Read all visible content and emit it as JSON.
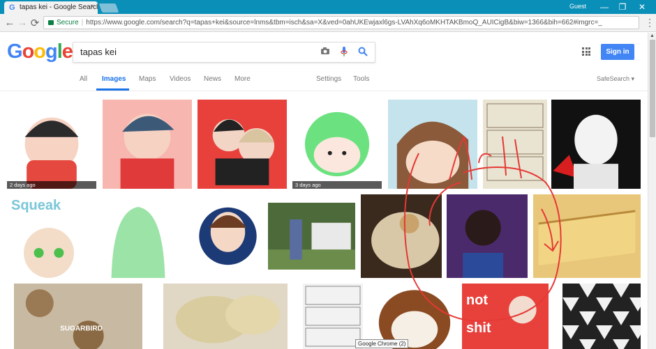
{
  "browser": {
    "tab_title": "tapas kei - Google Search",
    "tab_favicon": "G",
    "tab_close": "×",
    "user": "Guest",
    "window_buttons": [
      "—",
      "❐",
      "✕"
    ],
    "secure_label": "Secure",
    "url": "https://www.google.com/search?q=tapas+kei&source=lnms&tbm=isch&sa=X&ved=0ahUKEwjaxl6gs-LVAhXq6oMKHTAKBmoQ_AUICigB&biw=1366&bih=662#imgrc=_",
    "nav_icons": [
      "←",
      "→",
      "⟳"
    ],
    "menu_icon": "⋮"
  },
  "google": {
    "logo_letters": [
      {
        "char": "G",
        "color": "#4285f4"
      },
      {
        "char": "o",
        "color": "#ea4335"
      },
      {
        "char": "o",
        "color": "#fbbc05"
      },
      {
        "char": "g",
        "color": "#4285f4"
      },
      {
        "char": "l",
        "color": "#34a853"
      },
      {
        "char": "e",
        "color": "#ea4335"
      }
    ],
    "query": "tapas kei",
    "sign_in": "Sign in"
  },
  "tabs": {
    "all": "All",
    "images": "Images",
    "maps": "Maps",
    "videos": "Videos",
    "news": "News",
    "more": "More",
    "settings": "Settings",
    "tools": "Tools",
    "safesearch": "SafeSearch ▾"
  },
  "results": {
    "rows": [
      [
        {
          "subject": "chibi boy red hoodie",
          "bg": "#ffffff",
          "timestamp": "2 days ago"
        },
        {
          "subject": "boy red shirt wink",
          "bg": "#f7b7b0",
          "timestamp": ""
        },
        {
          "subject": "couple red scarf",
          "bg": "#e8413c",
          "timestamp": ""
        },
        {
          "subject": "green hair chibi",
          "bg": "#ffffff",
          "timestamp": "3 days ago"
        },
        {
          "subject": "brown hair boy",
          "bg": "#c5e3ec",
          "timestamp": ""
        },
        {
          "subject": "comic page",
          "bg": "#e9e3d2",
          "timestamp": ""
        },
        {
          "subject": "boy black white",
          "bg": "#111111",
          "timestamp": ""
        }
      ],
      [
        {
          "subject": "squeak tales girl",
          "bg": "#ffffff",
          "timestamp": ""
        },
        {
          "subject": "green ghost sketch",
          "bg": "#ffffff",
          "timestamp": ""
        },
        {
          "subject": "horned girl",
          "bg": "#ffffff",
          "timestamp": ""
        },
        {
          "subject": "woman outdoors photo",
          "bg": "#4d6b3a",
          "timestamp": ""
        },
        {
          "subject": "tapas dish",
          "bg": "#3a2a1e",
          "timestamp": ""
        },
        {
          "subject": "dark portrait",
          "bg": "#4a2a6a",
          "timestamp": ""
        },
        {
          "subject": "tortilla slices",
          "bg": "#e8c77a",
          "timestamp": ""
        }
      ],
      [
        {
          "subject": "sugarbird bakery",
          "bg": "#c8b9a2",
          "timestamp": ""
        },
        {
          "subject": "potatoes with sauce",
          "bg": "#e0d8c5",
          "timestamp": ""
        },
        {
          "subject": "comic page 2",
          "bg": "#f2f2f2",
          "timestamp": ""
        },
        {
          "subject": "cartoon raccoon",
          "bg": "#ffffff",
          "timestamp": ""
        },
        {
          "subject": "not shit poster",
          "bg": "#e8413c",
          "timestamp": ""
        },
        {
          "subject": "black white tiles",
          "bg": "#222222",
          "timestamp": ""
        }
      ]
    ]
  },
  "overlay_labels": {
    "sugarbird": "SUGARBIRD",
    "not": "not",
    "shit": "shit",
    "squeak": "Squeak"
  },
  "tooltip": "Google Chrome (2)",
  "colors": {
    "accent": "#1a73e8",
    "signin": "#4285f4",
    "titlebar": "#0a8fb8",
    "annotation": "#e53935"
  }
}
